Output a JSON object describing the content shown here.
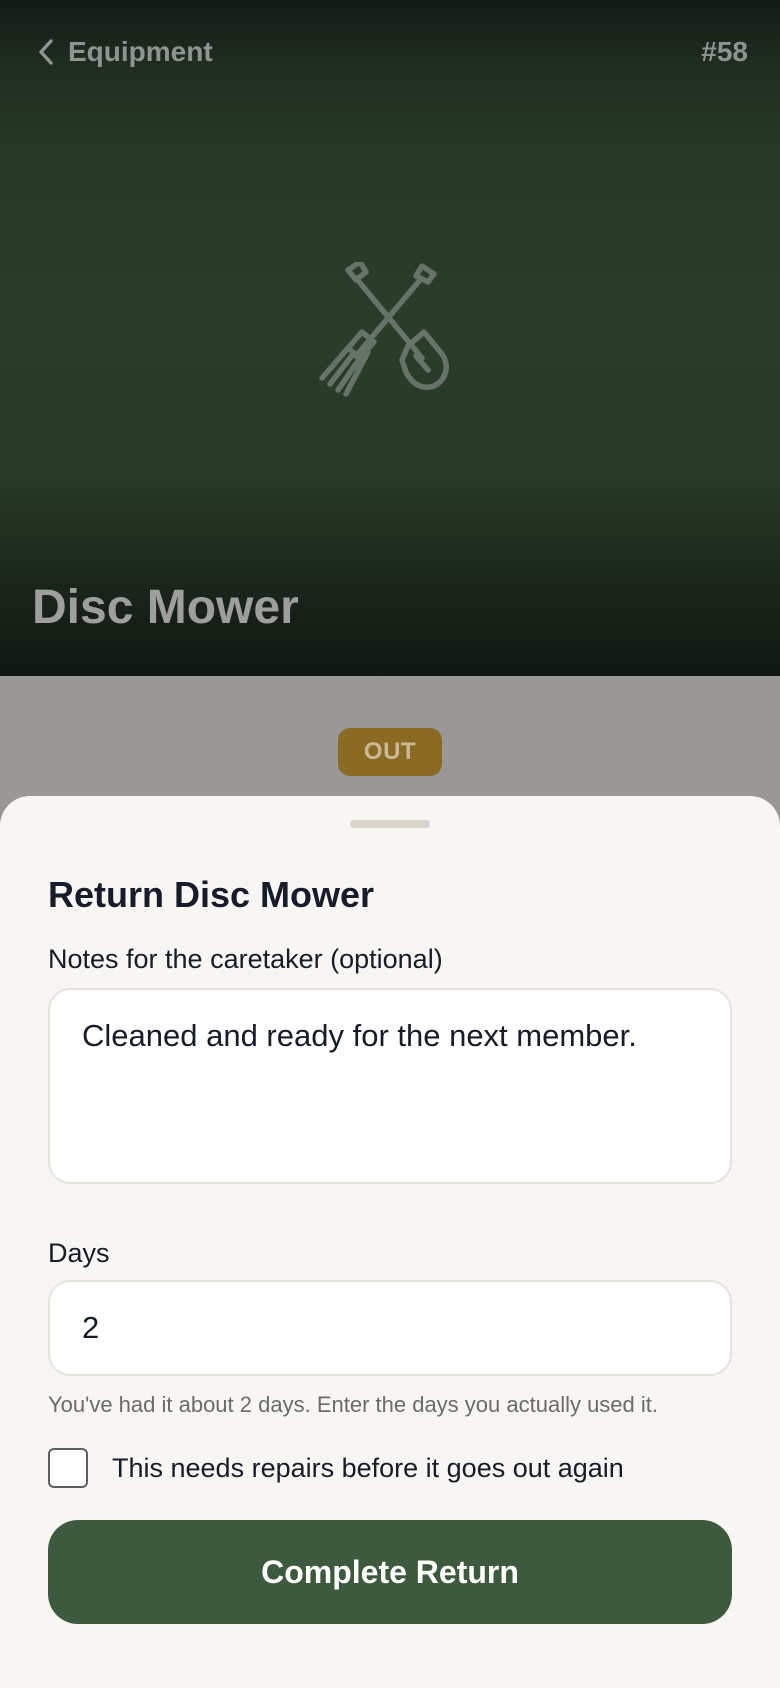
{
  "header": {
    "back_label": "Equipment",
    "item_number": "#58",
    "hero_icon": "crossed-fork-and-shovel-icon",
    "title": "Disc Mower"
  },
  "status": {
    "badge": "OUT",
    "badge_color": "#8b6a24"
  },
  "sheet": {
    "title": "Return Disc Mower",
    "notes": {
      "label": "Notes for the caretaker (optional)",
      "value": "Cleaned and ready for the next member."
    },
    "days": {
      "label": "Days",
      "value": "2",
      "hint": "You've had it about 2 days. Enter the days you actually used it."
    },
    "repairs": {
      "label": "This needs repairs before it goes out again",
      "checked": false
    },
    "submit_label": "Complete Return"
  },
  "colors": {
    "accent": "#3e5a3e",
    "hero_background": "#2a3d2a",
    "sheet_background": "#f8f6f3",
    "text_primary": "#161c29"
  }
}
